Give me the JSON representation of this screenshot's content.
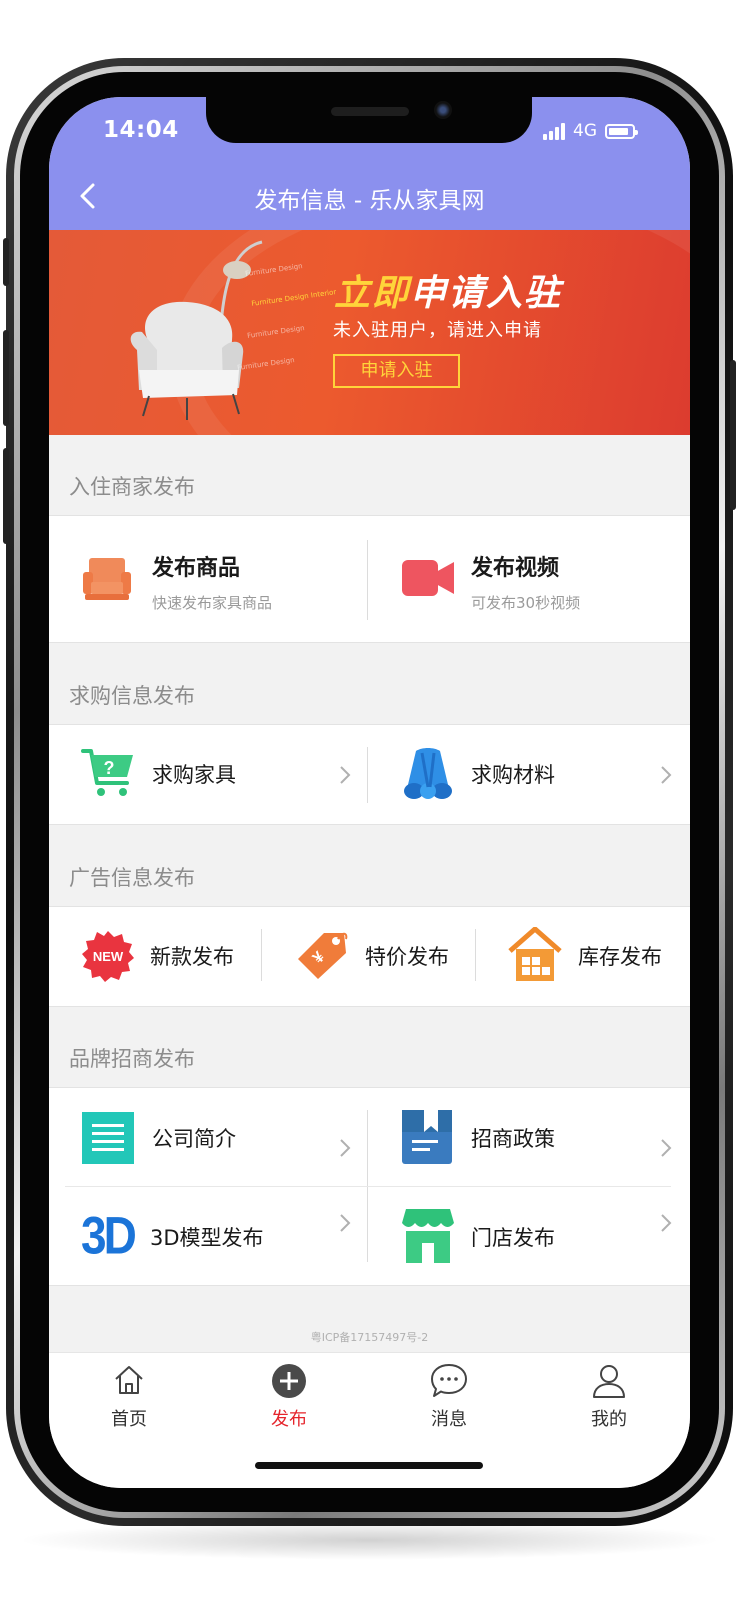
{
  "status_bar": {
    "time": "14:04",
    "network": "4G"
  },
  "header": {
    "title": "发布信息 - 乐从家具网",
    "back_icon": "chevron-left-icon"
  },
  "banner": {
    "headline_part1": "立即",
    "headline_part2": "申请入驻",
    "subtitle": "未入驻用户，请进入申请",
    "button": "申请入驻",
    "decor_text": [
      "Furniture Design",
      "Furniture Design Interior",
      "Furniture Design",
      "Furniture Design"
    ]
  },
  "sections": {
    "merchant": {
      "title": "入住商家发布",
      "items": [
        {
          "label": "发布商品",
          "sub": "快速发布家具商品",
          "icon": "sofa-icon"
        },
        {
          "label": "发布视频",
          "sub": "可发布30秒视频",
          "icon": "video-camera-icon"
        }
      ]
    },
    "purchase": {
      "title": "求购信息发布",
      "items": [
        {
          "label": "求购家具",
          "icon": "shopping-cart-icon"
        },
        {
          "label": "求购材料",
          "icon": "fabric-rolls-icon"
        }
      ]
    },
    "ads": {
      "title": "广告信息发布",
      "items": [
        {
          "label": "新款发布",
          "icon": "new-badge-icon",
          "badge": "NEW"
        },
        {
          "label": "特价发布",
          "icon": "price-tag-icon"
        },
        {
          "label": "库存发布",
          "icon": "warehouse-icon"
        }
      ]
    },
    "brand": {
      "title": "品牌招商发布",
      "items": [
        {
          "label": "公司简介",
          "icon": "list-document-icon"
        },
        {
          "label": "招商政策",
          "icon": "bookmark-book-icon"
        },
        {
          "label": "3D模型发布",
          "icon": "3d-icon",
          "icon_text": "3D"
        },
        {
          "label": "门店发布",
          "icon": "storefront-icon"
        }
      ]
    }
  },
  "footer": {
    "icp": "粤ICP备17157497号-2"
  },
  "tabbar": {
    "tabs": [
      {
        "label": "首页",
        "icon": "home-icon"
      },
      {
        "label": "发布",
        "icon": "plus-circle-icon",
        "active": true
      },
      {
        "label": "消息",
        "icon": "chat-bubble-icon"
      },
      {
        "label": "我的",
        "icon": "user-icon"
      }
    ]
  },
  "colors": {
    "header_bg": "#8b90ee",
    "banner_bg": "#e4512f",
    "banner_accent": "#ffd43a",
    "active_tab": "#e5242b",
    "section_title": "#8c8c8c"
  }
}
